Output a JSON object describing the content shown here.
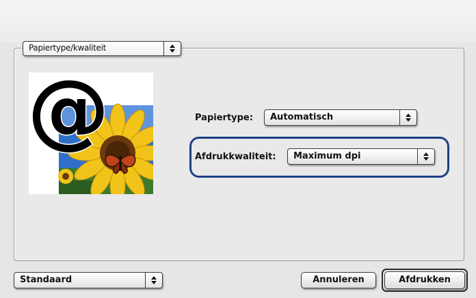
{
  "section_selector": {
    "value": "Papiertype/kwaliteit"
  },
  "paper_type": {
    "label": "Papiertype:",
    "value": "Automatisch"
  },
  "print_quality": {
    "label": "Afdrukkwaliteit:",
    "value": "Maximum dpi"
  },
  "preset_selector": {
    "value": "Standaard"
  },
  "buttons": {
    "cancel": "Annuleren",
    "print": "Afdrukken"
  },
  "colors": {
    "highlight": "#1c3f85",
    "sky": "#2f6fc9",
    "sunflower": "#f2c318"
  },
  "icons": {
    "popup_arrows": "up-down-arrows-icon",
    "preview": "at-sign-sunflower-preview-icon"
  }
}
